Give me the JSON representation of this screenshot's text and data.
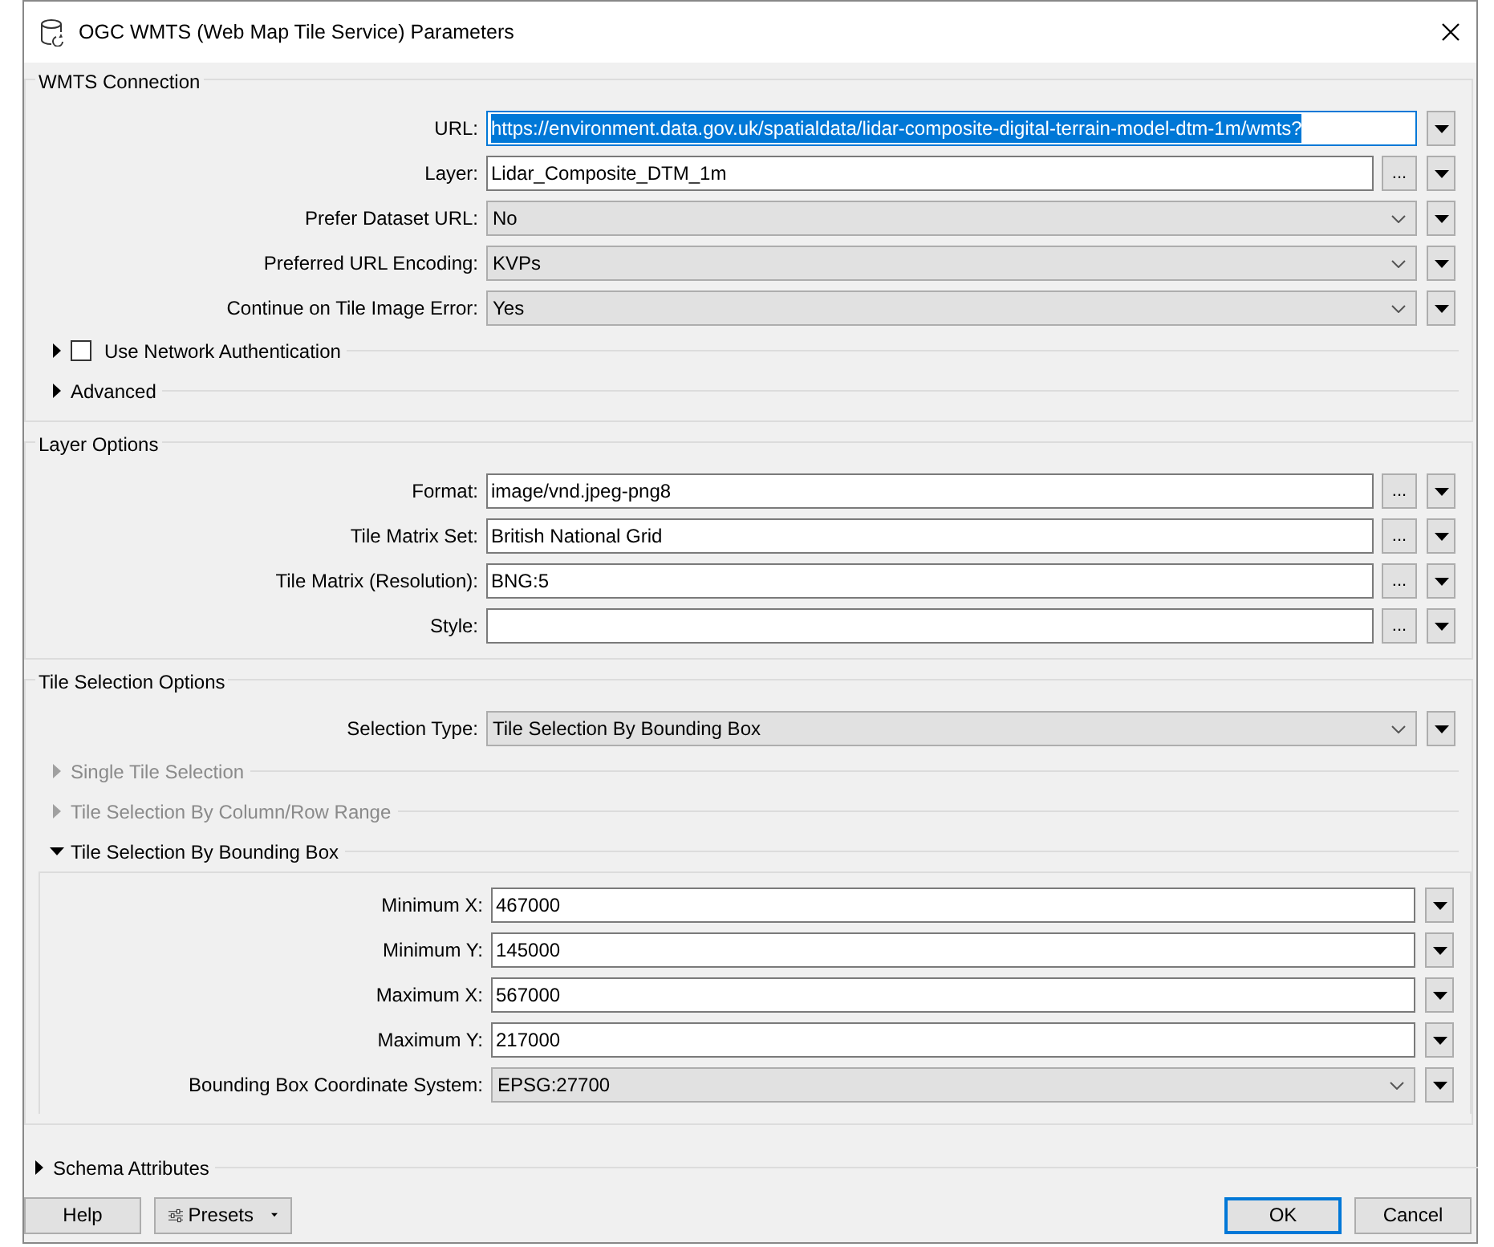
{
  "window": {
    "title": "OGC WMTS (Web Map Tile Service) Parameters"
  },
  "groups": [
    {
      "title": "WMTS Connection",
      "fields": [
        {
          "label": "URL:",
          "kind": "text",
          "value": "https://environment.data.gov.uk/spatialdata/lidar-composite-digital-terrain-model-dtm-1m/wmts?",
          "highlighted": true
        },
        {
          "label": "Layer:",
          "kind": "text",
          "value": "Lidar_Composite_DTM_1m",
          "browse": "...",
          "highlighted": false
        },
        {
          "label": "Prefer Dataset URL:",
          "kind": "select",
          "value": "No"
        },
        {
          "label": "Preferred URL Encoding:",
          "kind": "select",
          "value": "KVPs"
        },
        {
          "label": "Continue on Tile Image Error:",
          "kind": "select",
          "value": "Yes"
        }
      ],
      "subsections": [
        {
          "label": "Use Network Authentication",
          "kind": "checkbox",
          "checked": false,
          "expanded": false,
          "disabled": false
        },
        {
          "label": "Advanced",
          "kind": "plain",
          "expanded": false,
          "disabled": false
        }
      ]
    },
    {
      "title": "Layer Options",
      "fields": [
        {
          "label": "Format:",
          "kind": "text",
          "value": "image/vnd.jpeg-png8",
          "browse": "...",
          "highlighted": false
        },
        {
          "label": "Tile Matrix Set:",
          "kind": "text",
          "value": "British National Grid",
          "browse": "...",
          "highlighted": false
        },
        {
          "label": "Tile Matrix (Resolution):",
          "kind": "text",
          "value": "BNG:5",
          "browse": "...",
          "highlighted": false
        },
        {
          "label": "Style:",
          "kind": "text",
          "browse": "...",
          "highlighted": false
        }
      ]
    },
    {
      "title": "Tile Selection Options",
      "fields": [
        {
          "label": "Selection Type:",
          "kind": "select",
          "value": "Tile Selection By Bounding Box"
        }
      ],
      "subsections": [
        {
          "label": "Single Tile Selection",
          "kind": "plain",
          "expanded": false,
          "disabled": true
        },
        {
          "label": "Tile Selection By Column/Row Range",
          "kind": "plain",
          "expanded": false,
          "disabled": true
        },
        {
          "label": "Tile Selection By Bounding Box",
          "kind": "plain",
          "expanded": true,
          "disabled": false,
          "fields": [
            {
              "label": "Minimum X:",
              "kind": "text",
              "value": "467000",
              "highlighted": false
            },
            {
              "label": "Minimum Y:",
              "kind": "text",
              "value": "145000",
              "highlighted": false
            },
            {
              "label": "Maximum X:",
              "kind": "text",
              "value": "567000",
              "highlighted": false
            },
            {
              "label": "Maximum Y:",
              "kind": "text",
              "value": "217000",
              "highlighted": false
            },
            {
              "label": "Bounding Box Coordinate System:",
              "kind": "select",
              "value": "EPSG:27700"
            }
          ]
        }
      ]
    }
  ],
  "schema": {
    "label": "Schema Attributes",
    "expanded": false
  },
  "buttons": [
    {
      "label": "Help",
      "kind": "plain"
    },
    {
      "label": "Presets",
      "kind": "menu"
    },
    {
      "label": "OK",
      "kind": "default"
    },
    {
      "label": "Cancel",
      "kind": "plain"
    }
  ]
}
